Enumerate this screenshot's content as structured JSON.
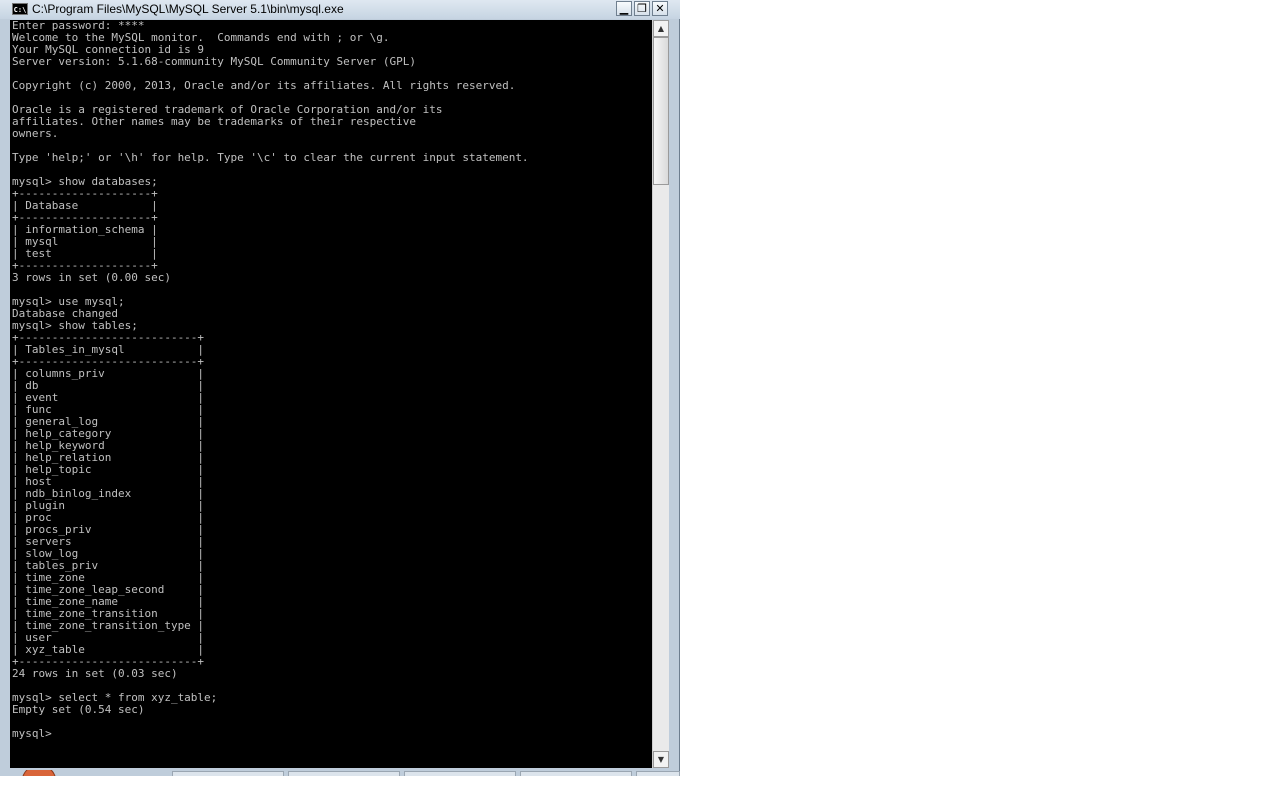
{
  "window": {
    "title": "C:\\Program Files\\MySQL\\MySQL Server 5.1\\bin\\mysql.exe",
    "icon": "console-icon",
    "icon_text": "C:\\",
    "controls": {
      "minimize": "▁",
      "maximize": "❐",
      "close": "✕"
    }
  },
  "console": {
    "lines": [
      "Enter password: ****",
      "Welcome to the MySQL monitor.  Commands end with ; or \\g.",
      "Your MySQL connection id is 9",
      "Server version: 5.1.68-community MySQL Community Server (GPL)",
      "",
      "Copyright (c) 2000, 2013, Oracle and/or its affiliates. All rights reserved.",
      "",
      "Oracle is a registered trademark of Oracle Corporation and/or its",
      "affiliates. Other names may be trademarks of their respective",
      "owners.",
      "",
      "Type 'help;' or '\\h' for help. Type '\\c' to clear the current input statement.",
      "",
      "mysql> show databases;",
      "+--------------------+",
      "| Database           |",
      "+--------------------+",
      "| information_schema |",
      "| mysql              |",
      "| test               |",
      "+--------------------+",
      "3 rows in set (0.00 sec)",
      "",
      "mysql> use mysql;",
      "Database changed",
      "mysql> show tables;",
      "+---------------------------+",
      "| Tables_in_mysql           |",
      "+---------------------------+",
      "| columns_priv              |",
      "| db                        |",
      "| event                     |",
      "| func                      |",
      "| general_log               |",
      "| help_category             |",
      "| help_keyword              |",
      "| help_relation             |",
      "| help_topic                |",
      "| host                      |",
      "| ndb_binlog_index          |",
      "| plugin                    |",
      "| proc                      |",
      "| procs_priv                |",
      "| servers                   |",
      "| slow_log                  |",
      "| tables_priv               |",
      "| time_zone                 |",
      "| time_zone_leap_second     |",
      "| time_zone_name            |",
      "| time_zone_transition      |",
      "| time_zone_transition_type |",
      "| user                      |",
      "| xyz_table                 |",
      "+---------------------------+",
      "24 rows in set (0.03 sec)",
      "",
      "mysql> select * from xyz_table;",
      "Empty set (0.54 sec)",
      "",
      "mysql>"
    ]
  },
  "scrollbar": {
    "up_arrow": "▲",
    "down_arrow": "▼"
  },
  "colors": {
    "console_bg": "#000000",
    "console_fg": "#c0c0c0",
    "titlebar": "#c6d4e2"
  }
}
